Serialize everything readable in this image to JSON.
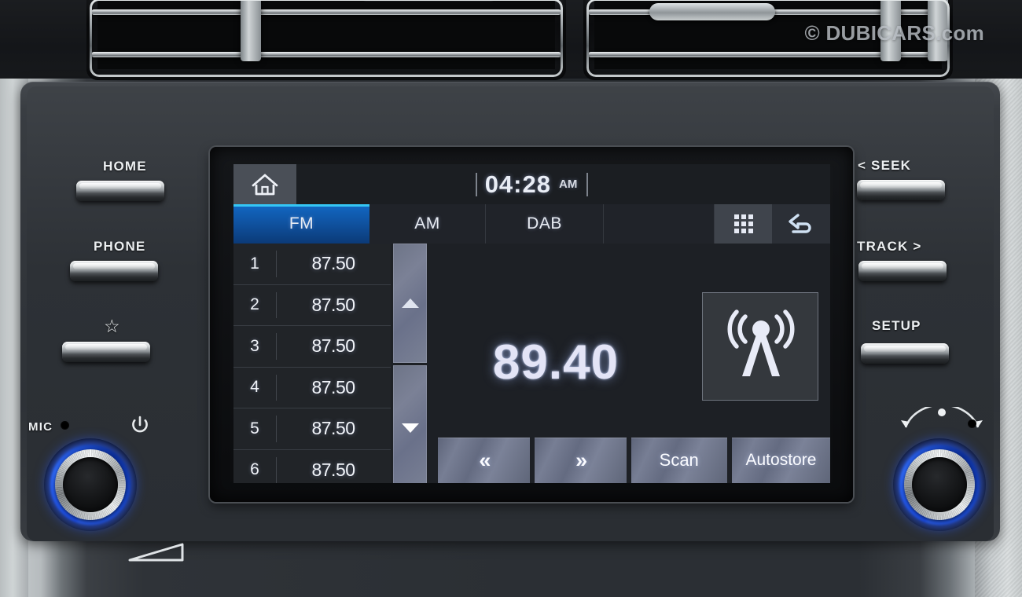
{
  "watermark": "© DUBICARS.com",
  "screen": {
    "home_icon": "home-icon",
    "clock": {
      "time": "04:28",
      "meridiem": "AM"
    },
    "tabs": [
      {
        "label": "FM",
        "active": true
      },
      {
        "label": "AM",
        "active": false
      },
      {
        "label": "DAB",
        "active": false
      }
    ],
    "grid_icon": "app-grid-icon",
    "back_icon": "back-arrow-icon",
    "presets": [
      {
        "number": "1",
        "frequency": "87.50"
      },
      {
        "number": "2",
        "frequency": "87.50"
      },
      {
        "number": "3",
        "frequency": "87.50"
      },
      {
        "number": "4",
        "frequency": "87.50"
      },
      {
        "number": "5",
        "frequency": "87.50"
      },
      {
        "number": "6",
        "frequency": "87.50"
      }
    ],
    "scroll_up_icon": "scroll-up-arrow-icon",
    "scroll_down_icon": "scroll-down-arrow-icon",
    "current_frequency": "89.40",
    "antenna_icon": "radio-antenna-icon",
    "bottom_buttons": [
      {
        "label": "«",
        "name": "seek-down-button"
      },
      {
        "label": "»",
        "name": "seek-up-button"
      },
      {
        "label": "Scan",
        "name": "scan-button"
      },
      {
        "label": "Autostore",
        "name": "autostore-button"
      }
    ],
    "accent_blue": "#0f4f9b",
    "accent_cyan": "#35c6f4",
    "text_color": "#e8ecf3",
    "background": "#1d2025"
  },
  "hardware": {
    "left_buttons": [
      {
        "label": "HOME",
        "name": "home-hard-button"
      },
      {
        "label": "PHONE",
        "name": "phone-hard-button"
      },
      {
        "label": "☆",
        "name": "favorite-hard-button"
      }
    ],
    "right_buttons": [
      {
        "label": "< SEEK",
        "name": "seek-hard-button"
      },
      {
        "label": "TRACK >",
        "name": "track-hard-button"
      },
      {
        "label": "SETUP",
        "name": "setup-hard-button"
      }
    ],
    "mic_label": "MIC",
    "power_icon": "power-icon",
    "left_knob": "volume-power-knob",
    "right_knob": "tune-select-knob",
    "knob_ring_color": "#1b52ff",
    "volume_indicator_icon": "volume-level-icon",
    "tune_arc_icon": "tune-arc-icon"
  }
}
